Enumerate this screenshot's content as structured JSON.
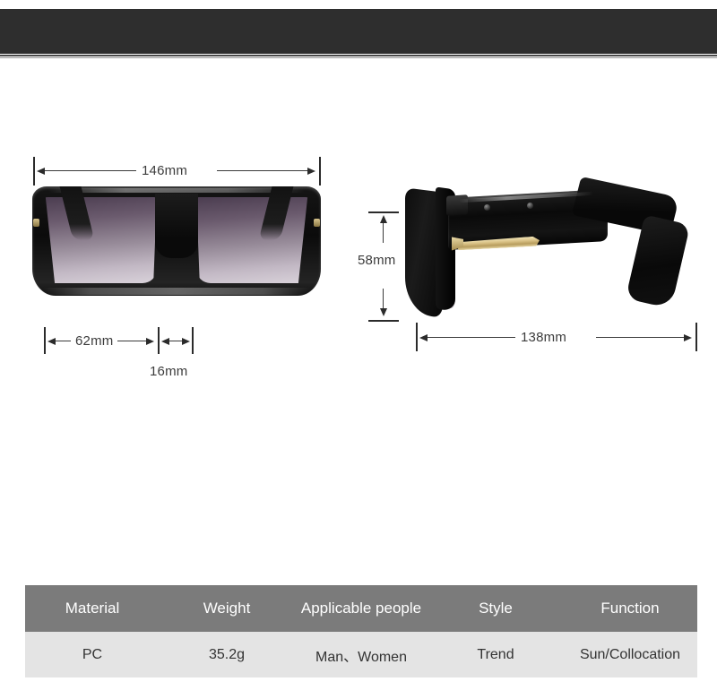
{
  "banner": {
    "name": "top-dark-banner"
  },
  "product": {
    "front_view": {
      "name": "sunglasses-front-view",
      "frame_color": "#0b0b0b",
      "lens_gradient_top": "#4b3d50",
      "lens_gradient_bottom": "#d9d2da"
    },
    "side_view": {
      "name": "sunglasses-side-view",
      "frame_color": "#0a0a0a",
      "accent_color": "#d8c084"
    }
  },
  "dimensions": {
    "front_width": "146mm",
    "lens_width": "62mm",
    "bridge_width": "16mm",
    "lens_height": "58mm",
    "temple_length": "138mm"
  },
  "spec_table": {
    "headers": [
      "Material",
      "Weight",
      "Applicable people",
      "Style",
      "Function"
    ],
    "rows": [
      [
        "PC",
        "35.2g",
        "Man、Women",
        "Trend",
        "Sun/Collocation"
      ]
    ]
  },
  "colors": {
    "banner": "#2e2e2e",
    "table_header_bg": "#7b7b7b",
    "table_row_bg": "#e4e4e4",
    "dimension_line": "#2b2b2b",
    "page_background": "#ffffff"
  }
}
